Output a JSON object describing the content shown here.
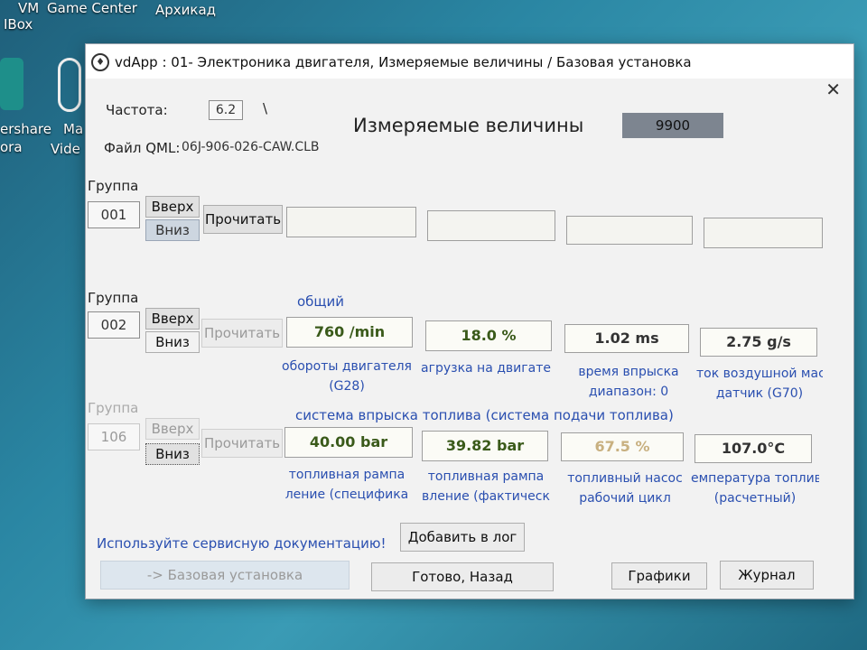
{
  "desktop": {
    "labels": [
      "VM",
      "Game Center",
      "Архикад",
      "IBox",
      "ershare",
      "ora",
      "Vide",
      "Ma"
    ]
  },
  "window": {
    "title": "vdApp : 01- Электроника двигателя,  Измеряемые величины / Базовая установка",
    "close_glyph": "✕"
  },
  "header": {
    "frequency_label": "Частота:",
    "frequency_value": "6.2",
    "spinner_glyph": "\\",
    "file_label": "Файл QML:",
    "file_value": "06J-906-026-CAW.CLB",
    "heading": "Измеряемые величины",
    "counter": "9900"
  },
  "groups": [
    {
      "label": "Группа",
      "number": "001",
      "up": "Вверх",
      "down": "Вниз",
      "read": "Прочитать",
      "section": "",
      "values": [
        "",
        "",
        "",
        ""
      ],
      "captions": [
        "",
        "",
        "",
        ""
      ]
    },
    {
      "label": "Группа",
      "number": "002",
      "up": "Вверх",
      "down": "Вниз",
      "read": "Прочитать",
      "section": "общий",
      "values": [
        "760 /min",
        "18.0 %",
        "1.02 ms",
        "2.75 g/s"
      ],
      "captions": [
        [
          "обороты двигателя",
          "(G28)"
        ],
        [
          "агрузка на двигате",
          ""
        ],
        [
          "время впрыска",
          "диапазон: 0"
        ],
        [
          "ток воздушной мас",
          "датчик (G70)"
        ]
      ]
    },
    {
      "label": "Группа",
      "number": "106",
      "up": "Вверх",
      "down": "Вниз",
      "read": "Прочитать",
      "section": "система впрыска топлива (система подачи топлива)",
      "values": [
        "40.00 bar",
        "39.82 bar",
        "67.5 %",
        "107.0°C"
      ],
      "captions": [
        [
          "топливная рампа",
          "ление (специфика"
        ],
        [
          "топливная рампа",
          "вление (фактическ"
        ],
        [
          "топливный насос",
          "рабочий цикл"
        ],
        [
          "емпература топлив",
          "(расчетный)"
        ]
      ]
    }
  ],
  "footer": {
    "notice": "Используйте сервисную документацию!",
    "add_log": "Добавить в лог",
    "basic_setting": "-> Базовая установка",
    "done_back": "Готово, Назад",
    "graphs": "Графики",
    "journal": "Журнал"
  },
  "colors": {
    "caption_blue": "#2a4fb0",
    "value_green": "#3a5a1a",
    "counter_bg": "#7d8590"
  }
}
